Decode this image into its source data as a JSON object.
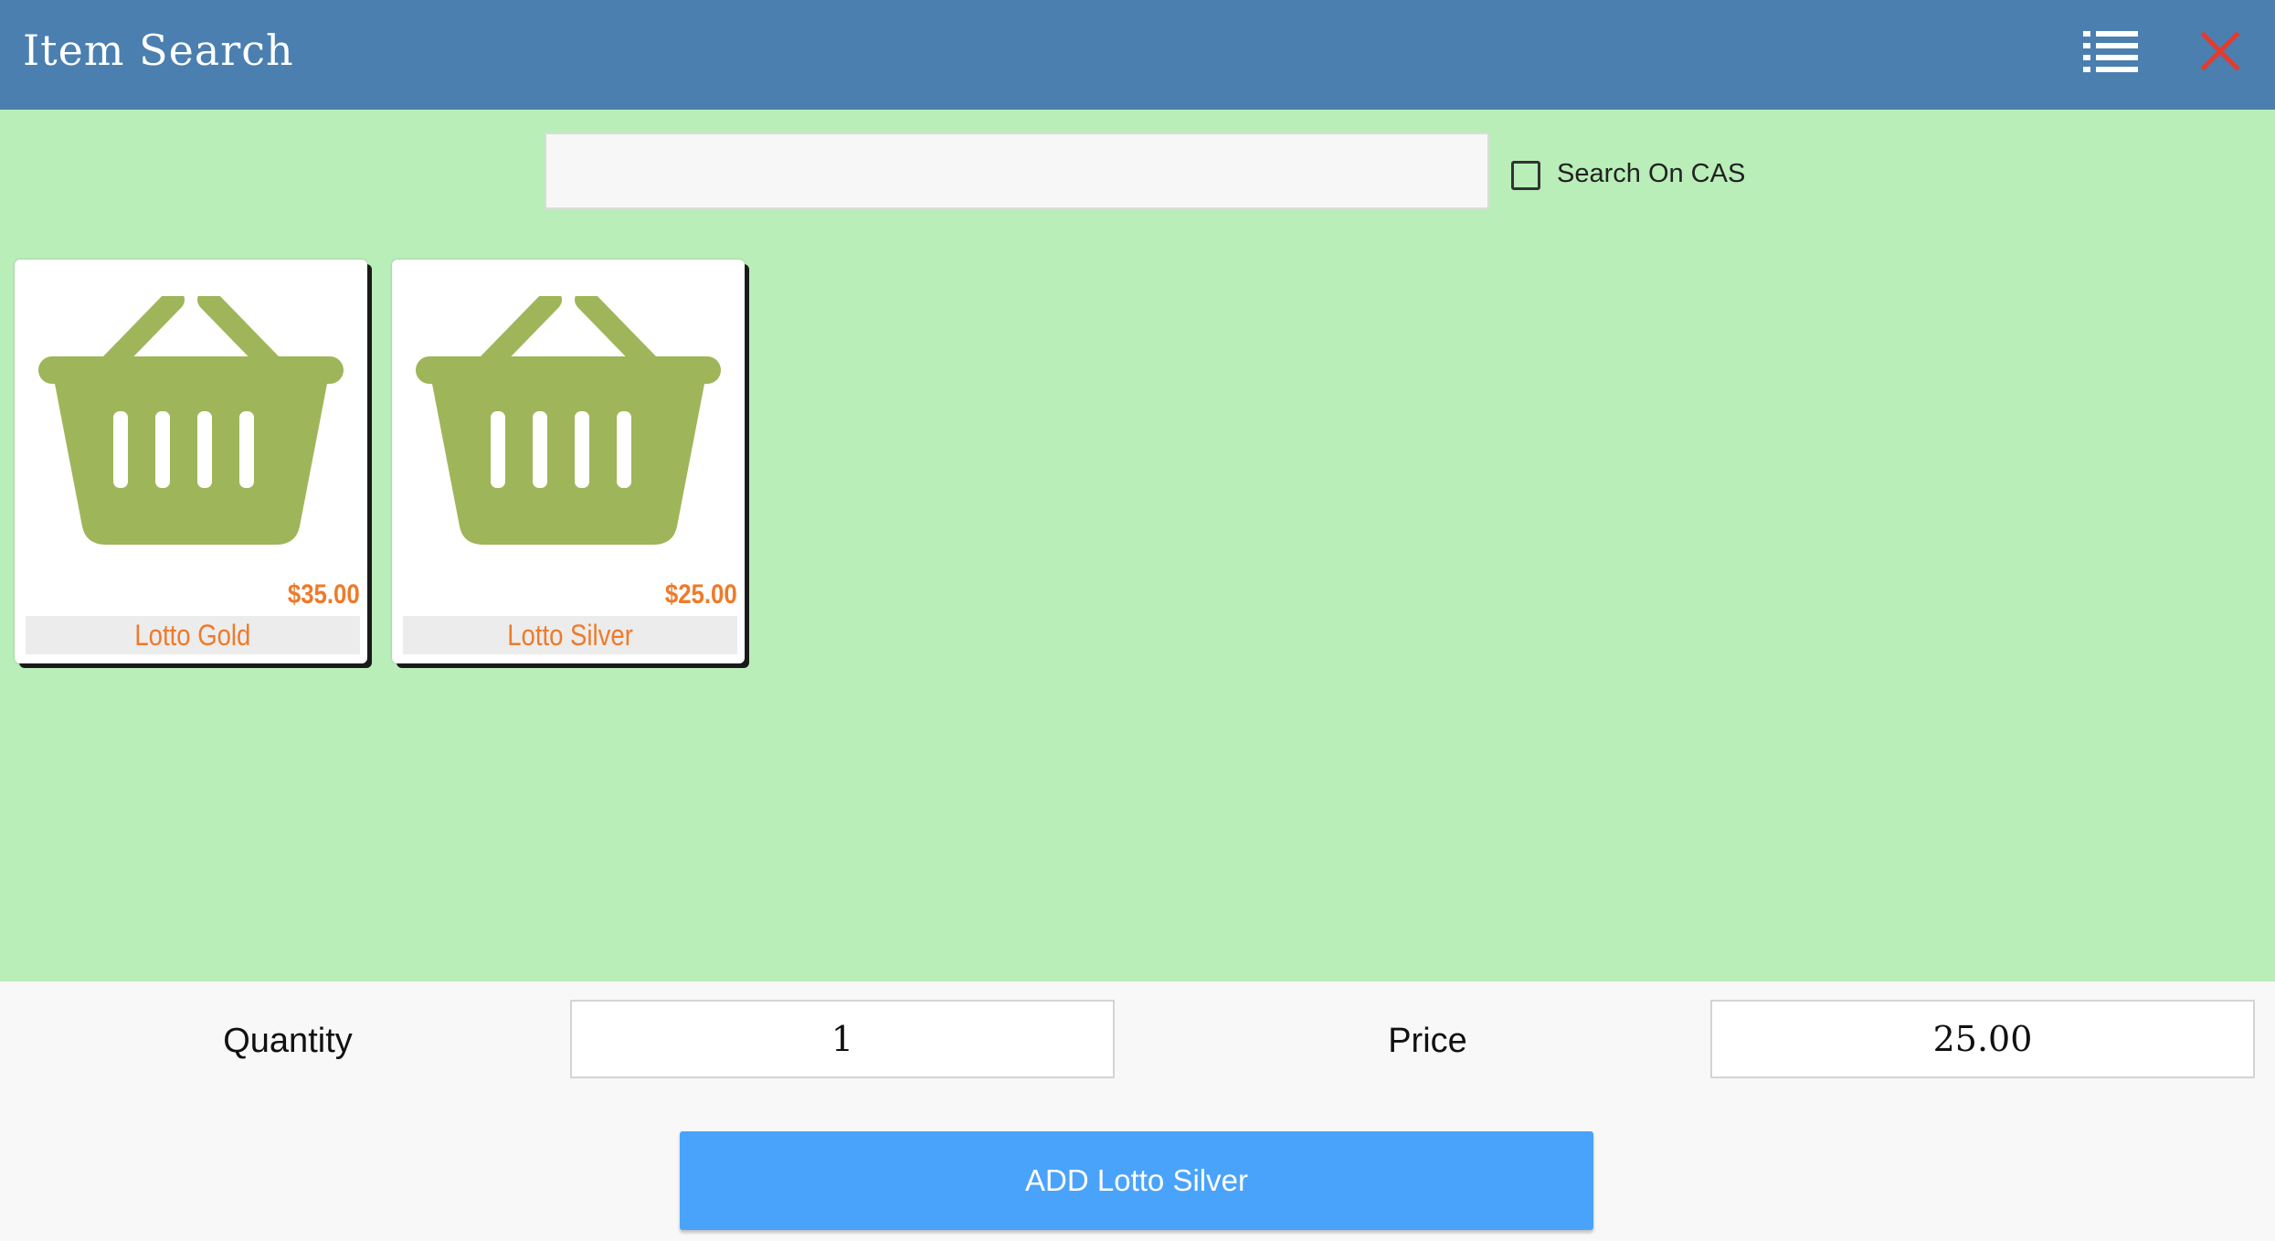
{
  "header": {
    "title": "Item Search",
    "menu_icon": "list-icon",
    "close_icon": "close-icon",
    "close_color": "#e33b2e"
  },
  "search": {
    "value": "",
    "placeholder": "",
    "cas_label": "Search On CAS",
    "cas_checked": false
  },
  "items": [
    {
      "name": "Lotto Gold",
      "price": "$35.00",
      "icon": "basket-icon"
    },
    {
      "name": "Lotto Silver",
      "price": "$25.00",
      "icon": "basket-icon"
    }
  ],
  "bottom": {
    "quantity_label": "Quantity",
    "quantity_value": "1",
    "price_label": "Price",
    "price_value": "25.00",
    "add_button_label": "ADD Lotto Silver"
  },
  "colors": {
    "header_bg": "#4a7fb0",
    "content_bg": "#b9eeb9",
    "basket": "#9fb55a",
    "accent_orange": "#ef7a29",
    "add_button": "#4aa3fb"
  }
}
